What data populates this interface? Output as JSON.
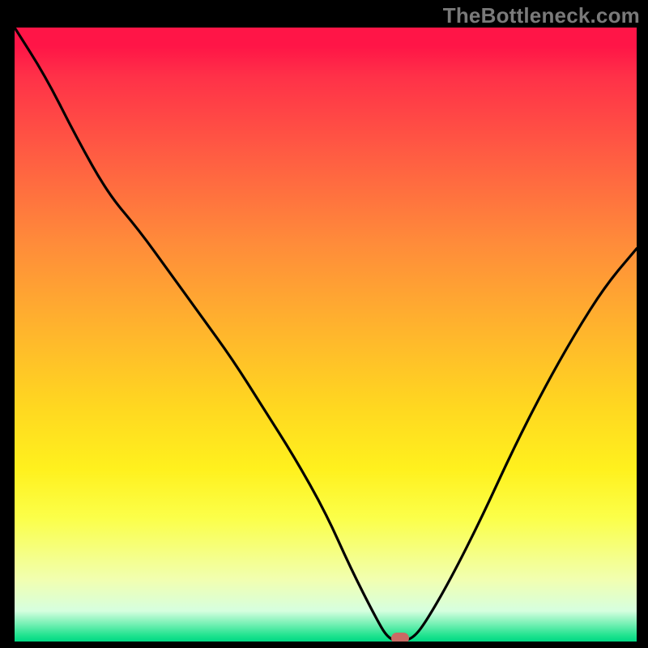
{
  "watermark": "TheBottleneck.com",
  "chart_data": {
    "type": "line",
    "title": "",
    "xlabel": "",
    "ylabel": "",
    "x": [
      0,
      5,
      10,
      15,
      20,
      25,
      30,
      35,
      40,
      45,
      50,
      54,
      58,
      60,
      62,
      64,
      66,
      70,
      75,
      80,
      85,
      90,
      95,
      100
    ],
    "values": [
      100,
      92,
      82,
      73,
      67,
      60,
      53,
      46,
      38,
      30,
      21,
      12,
      4,
      0.5,
      0,
      0.5,
      3,
      10,
      20,
      31,
      41,
      50,
      58,
      64
    ],
    "xlim": [
      0,
      100
    ],
    "ylim": [
      0,
      100
    ],
    "marker": {
      "x": 62,
      "y": 0
    },
    "colors": {
      "top": "#ff1547",
      "mid": "#fff11e",
      "bottom": "#00d884",
      "curve": "#000000",
      "marker": "#c96a64",
      "frame": "#000000"
    }
  }
}
